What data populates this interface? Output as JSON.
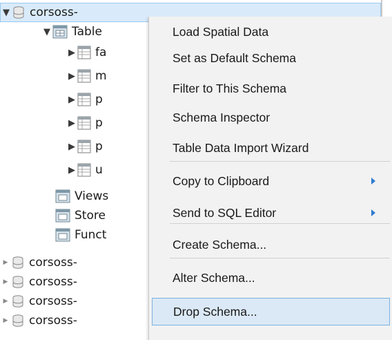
{
  "tree": {
    "root_schema_label": "corsoss-",
    "tables_label": "Table",
    "table_children": [
      "fa",
      "m",
      "p",
      "p",
      "p",
      "u"
    ],
    "views_label": "Views",
    "stored_label": "Store",
    "functions_label": "Funct",
    "other_schemas": [
      "corsoss-",
      "corsoss-",
      "corsoss-",
      "corsoss-"
    ]
  },
  "context_menu": {
    "items": [
      {
        "label": "Load Spatial Data"
      },
      {
        "label": "Set as Default Schema"
      },
      {
        "label": "Filter to This Schema"
      },
      {
        "label": "Schema Inspector"
      },
      {
        "label": "Table Data Import Wizard"
      },
      {
        "label": "Copy to Clipboard",
        "submenu": true
      },
      {
        "label": "Send to SQL Editor",
        "submenu": true
      },
      {
        "label": "Create Schema..."
      },
      {
        "label": "Alter Schema..."
      },
      {
        "label": "Drop Schema...",
        "highlighted": true
      }
    ]
  },
  "colors": {
    "menu_bg": "#f2f2f2",
    "highlight_bg": "#dbe9f6",
    "highlight_border": "#7ab0e0",
    "submenu_arrow": "#2f7bd1",
    "selection_bg": "#d9ebfa"
  },
  "icons": {
    "schema": "database-icon",
    "folder": "folder-table-icon",
    "table": "table-grid-icon"
  }
}
